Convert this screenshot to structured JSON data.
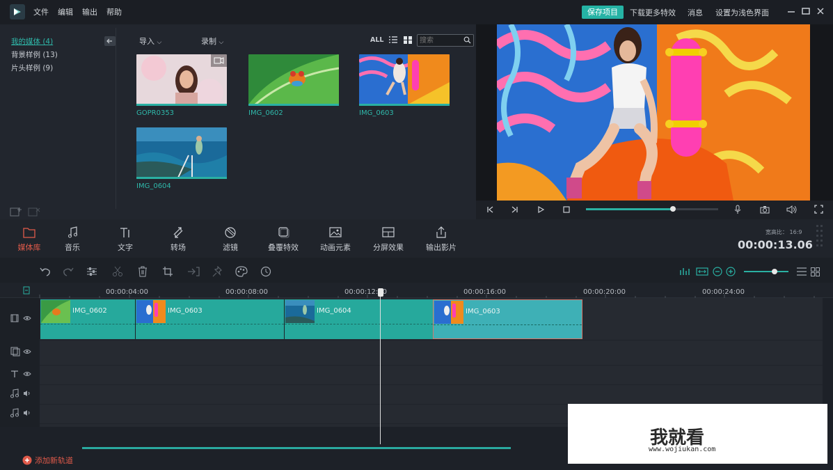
{
  "menu": [
    "文件",
    "编辑",
    "输出",
    "帮助"
  ],
  "topright": {
    "save": "保存项目",
    "download": "下载更多特效",
    "messages": "消息",
    "theme": "设置为浅色界面"
  },
  "sidebar": {
    "items": [
      "我的媒体 (4)",
      "背景样例 (13)",
      "片头样例 (9)"
    ]
  },
  "media_toolbar": {
    "import": "导入",
    "record": "录制",
    "all": "ALL",
    "search_placeholder": "搜索"
  },
  "media": [
    {
      "name": "GOPR0353"
    },
    {
      "name": "IMG_0602"
    },
    {
      "name": "IMG_0603"
    },
    {
      "name": "IMG_0604"
    }
  ],
  "tools": [
    "媒体库",
    "音乐",
    "文字",
    "转场",
    "滤镜",
    "叠覆特效",
    "动画元素",
    "分屏效果",
    "输出影片"
  ],
  "ratio": "宽高比： 16:9",
  "timecode": "00:00:13.06",
  "playback_progress": 0.66,
  "ruler": [
    "00:00:04:00",
    "00:00:08:00",
    "00:00:12:00",
    "00:00:16:00",
    "00:00:20:00",
    "00:00:24:00"
  ],
  "clips": [
    {
      "name": "IMG_0602"
    },
    {
      "name": "IMG_0603"
    },
    {
      "name": "IMG_0604"
    },
    {
      "name": "IMG_0603"
    }
  ],
  "add_track": "添加新轨道",
  "watermark": {
    "title": "我就看",
    "url": "www.wojiukan.com"
  },
  "colors": {
    "accent": "#25b3a5",
    "clip": "#26a99c",
    "active_tool": "#e05a4a"
  }
}
